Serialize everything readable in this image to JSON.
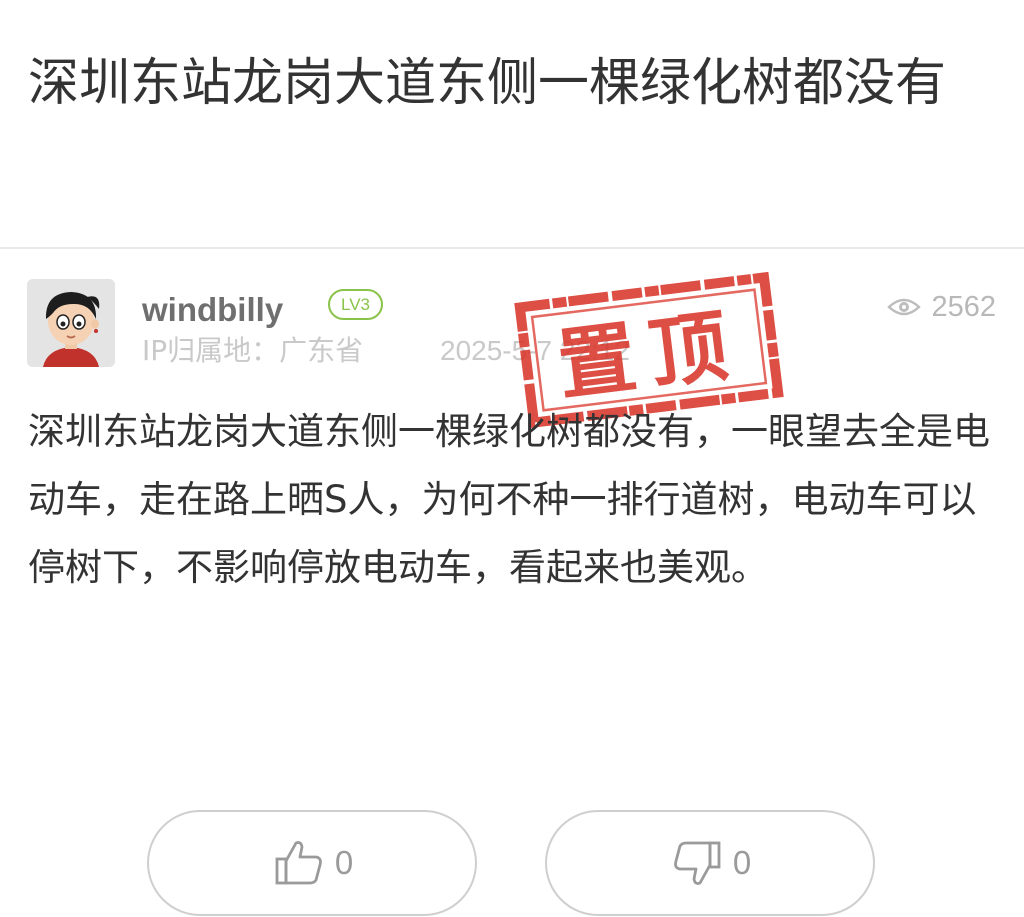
{
  "post": {
    "title": "深圳东站龙岗大道东侧一棵绿化树都没有",
    "body": "深圳东站龙岗大道东侧一棵绿化树都没有，一眼望去全是电动车，走在路上晒S人，为何不种一排行道树，电动车可以停树下，不影响停放电动车，看起来也美观。"
  },
  "author": {
    "username": "windbilly",
    "level": "LV3",
    "ip_location": "IP归属地：广东省",
    "date": "2025-5-7 22:12",
    "avatar_icon": "cartoon-avatar"
  },
  "stats": {
    "views": "2562",
    "view_icon": "eye-icon"
  },
  "stamp": {
    "text": "置顶",
    "color": "#d9362b"
  },
  "votes": {
    "upvote_count": "0",
    "downvote_count": "0",
    "upvote_icon": "thumbs-up-icon",
    "downvote_icon": "thumbs-down-icon"
  },
  "colors": {
    "level_badge": "#8bc34a",
    "stamp_red": "#d9362b",
    "muted_text": "#c9c9c9"
  }
}
